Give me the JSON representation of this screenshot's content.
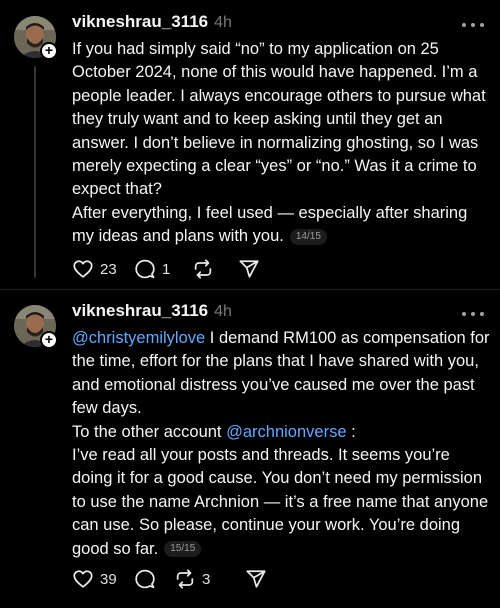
{
  "posts": [
    {
      "username": "vikneshrau_3116",
      "time": "4h",
      "paragraphs": [
        "If you had simply said “no” to my application on 25 October 2024, none of this would have happened. I’m a people leader. I always encourage others to pursue what they truly want and to keep asking until they get an answer. I don’t believe in normalizing ghosting, so I was merely expecting a clear “yes” or “no.” Was it a crime to expect that?",
        "After everything, I feel used — especially after sharing my ideas and plans with you."
      ],
      "counter": "14/15",
      "likes": "23",
      "replies": "1",
      "reposts": "",
      "icons": [
        "heart-icon",
        "comment-icon",
        "repost-icon",
        "share-icon"
      ]
    },
    {
      "username": "vikneshrau_3116",
      "time": "4h",
      "mention1": "@christyemilylove",
      "p1_text": " I demand RM100 as compensation for the time, effort for the plans that I have shared with you, and emotional distress you’ve caused me over the past few days.",
      "p2_prefix": "To the other account ",
      "mention2": "@archnionverse",
      "p2_suffix": " :",
      "p3_text": "I’ve read all your posts and threads. It seems you’re doing it for a good cause. You don’t need my permission to use the name Archnion — it’s a free name that anyone can use. So please, continue your work. You’re doing good so far.",
      "counter": "15/15",
      "likes": "39",
      "replies": "",
      "reposts": "3",
      "icons": [
        "heart-icon",
        "comment-icon",
        "repost-icon",
        "share-icon"
      ]
    }
  ]
}
